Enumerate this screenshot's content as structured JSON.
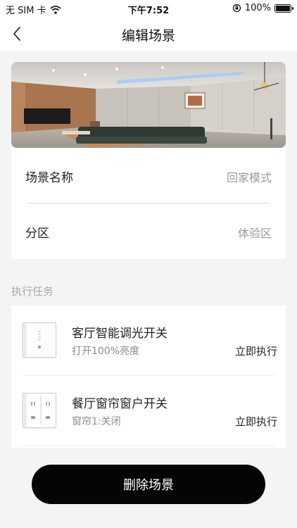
{
  "status_bar": {
    "carrier": "无 SIM 卡",
    "time": "下午7:52",
    "battery": "100%"
  },
  "header": {
    "title": "编辑场景"
  },
  "scene": {
    "name_label": "场景名称",
    "name_value": "回家模式",
    "zone_label": "分区",
    "zone_value": "体验区"
  },
  "tasks_section": {
    "title": "执行任务",
    "items": [
      {
        "name": "客厅智能调光开关",
        "action": "打开100%亮度",
        "exec": "立即执行",
        "icon": "dimmer-switch-icon"
      },
      {
        "name": "餐厅窗帘窗户开关",
        "action": "窗帘1:关闭",
        "exec": "立即执行",
        "icon": "curtain-switch-icon"
      }
    ]
  },
  "footer": {
    "delete_label": "删除场景"
  }
}
